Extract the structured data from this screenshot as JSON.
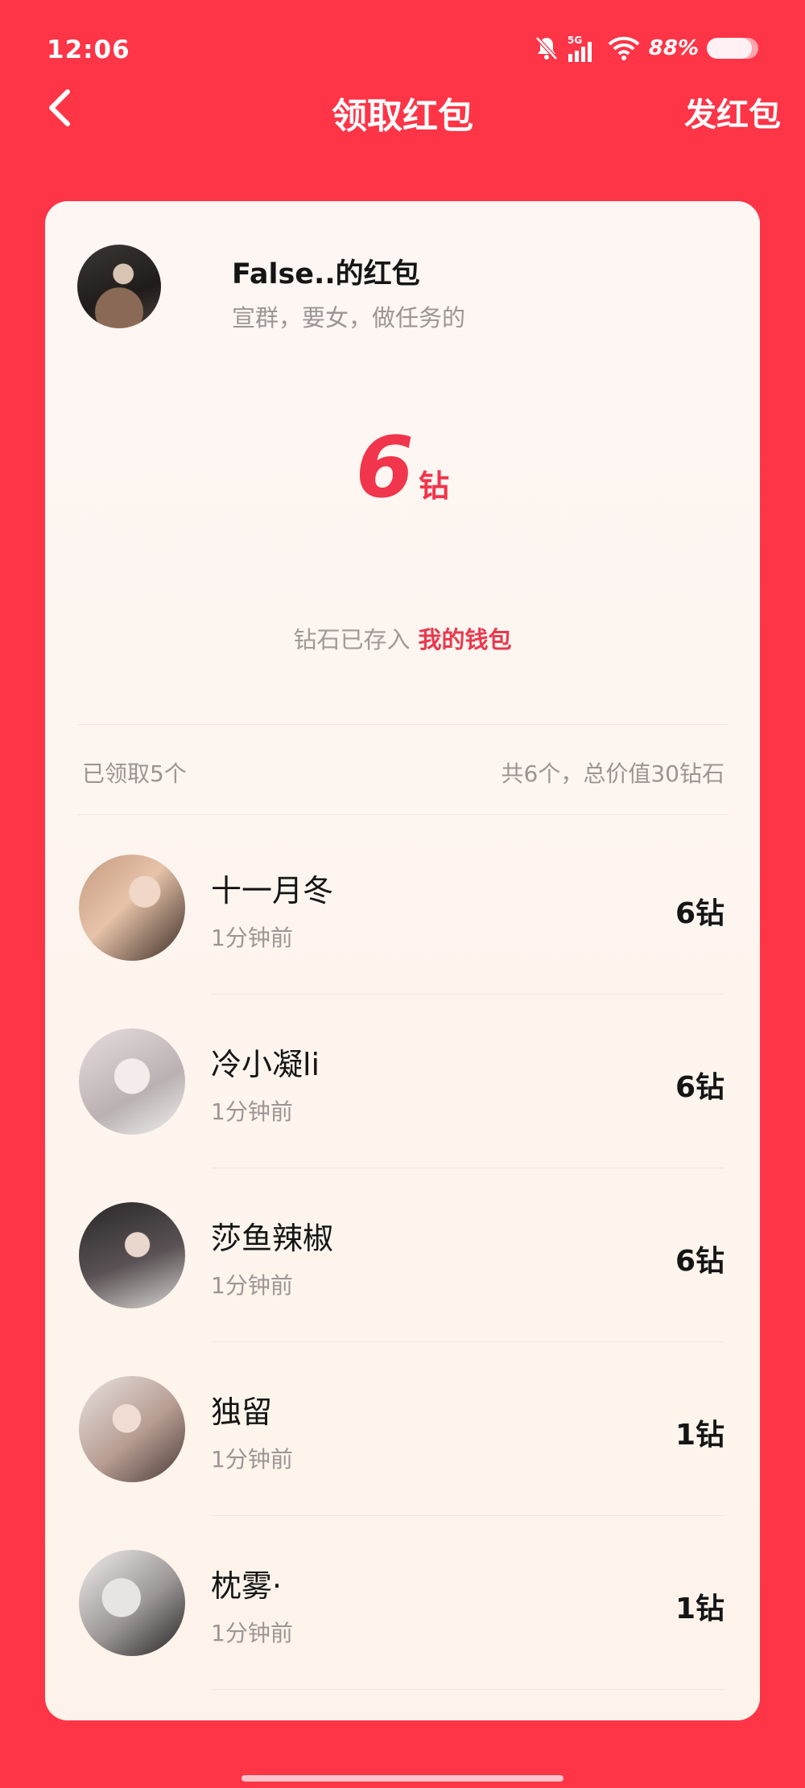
{
  "status_bar": {
    "time": "12:06",
    "network": "5G",
    "battery": "88%",
    "battery_level": 0.88,
    "icons": [
      "bell-off-icon",
      "signal-icon",
      "wifi-icon",
      "battery-icon"
    ]
  },
  "nav": {
    "back_icon": "chevron-left-icon",
    "title": "领取红包",
    "send_label": "发红包"
  },
  "sender": {
    "name": "False..的红包",
    "note": "宣群，要女，做任务的"
  },
  "received": {
    "amount": "6",
    "unit": "钻"
  },
  "deposit": {
    "text": "钻石已存入",
    "wallet_link": "我的钱包"
  },
  "summary": {
    "claimed": "已领取5个",
    "total": "共6个，总价值30钻石"
  },
  "claims": [
    {
      "name": "十一月冬",
      "time": "1分钟前",
      "amount": "6钻"
    },
    {
      "name": "冷小凝li",
      "time": "1分钟前",
      "amount": "6钻"
    },
    {
      "name": "莎鱼辣椒",
      "time": "1分钟前",
      "amount": "6钻"
    },
    {
      "name": "独留",
      "time": "1分钟前",
      "amount": "1钻"
    },
    {
      "name": "枕雾·",
      "time": "1分钟前",
      "amount": "1钻"
    }
  ],
  "colors": {
    "background": "#fe3447",
    "accent": "#f0354c",
    "card": "#fdf6f3"
  }
}
